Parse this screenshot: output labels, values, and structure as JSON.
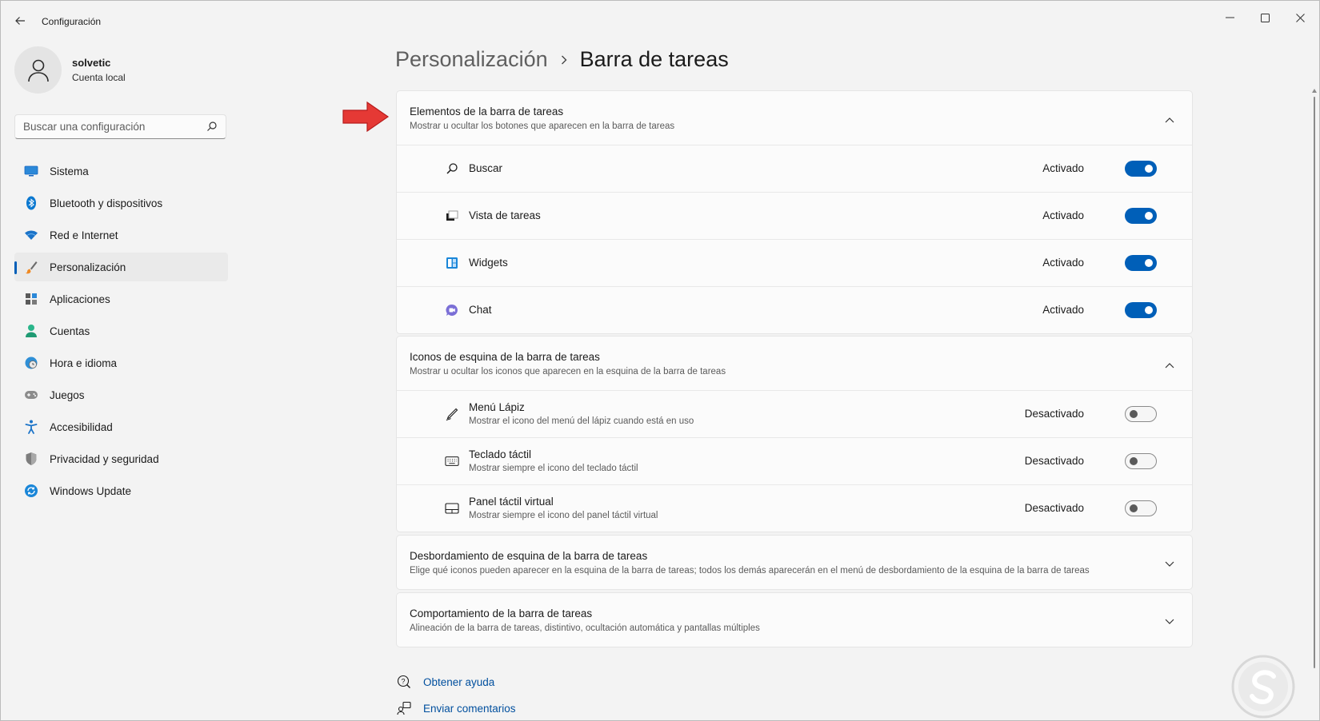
{
  "window": {
    "title": "Configuración"
  },
  "profile": {
    "name": "solvetic",
    "account_type": "Cuenta local"
  },
  "search": {
    "placeholder": "Buscar una configuración"
  },
  "sidebar": {
    "items": [
      {
        "label": "Sistema",
        "icon": "monitor-icon",
        "active": false
      },
      {
        "label": "Bluetooth y dispositivos",
        "icon": "bluetooth-icon",
        "active": false
      },
      {
        "label": "Red e Internet",
        "icon": "wifi-icon",
        "active": false
      },
      {
        "label": "Personalización",
        "icon": "brush-icon",
        "active": true
      },
      {
        "label": "Aplicaciones",
        "icon": "apps-icon",
        "active": false
      },
      {
        "label": "Cuentas",
        "icon": "person-icon",
        "active": false
      },
      {
        "label": "Hora e idioma",
        "icon": "clock-globe-icon",
        "active": false
      },
      {
        "label": "Juegos",
        "icon": "gamepad-icon",
        "active": false
      },
      {
        "label": "Accesibilidad",
        "icon": "accessibility-icon",
        "active": false
      },
      {
        "label": "Privacidad y seguridad",
        "icon": "shield-icon",
        "active": false
      },
      {
        "label": "Windows Update",
        "icon": "update-icon",
        "active": false
      }
    ]
  },
  "breadcrumb": {
    "parent": "Personalización",
    "current": "Barra de tareas"
  },
  "sections": {
    "taskbar_items": {
      "title": "Elementos de la barra de tareas",
      "subtitle": "Mostrar u ocultar los botones que aparecen en la barra de tareas",
      "expanded": true,
      "rows": [
        {
          "label": "Buscar",
          "state": "Activado",
          "on": true,
          "icon": "search-icon"
        },
        {
          "label": "Vista de tareas",
          "state": "Activado",
          "on": true,
          "icon": "task-view-icon"
        },
        {
          "label": "Widgets",
          "state": "Activado",
          "on": true,
          "icon": "widgets-icon"
        },
        {
          "label": "Chat",
          "state": "Activado",
          "on": true,
          "icon": "chat-icon"
        }
      ]
    },
    "corner_icons": {
      "title": "Iconos de esquina de la barra de tareas",
      "subtitle": "Mostrar u ocultar los iconos que aparecen en la esquina de la barra de tareas",
      "expanded": true,
      "rows": [
        {
          "label": "Menú Lápiz",
          "desc": "Mostrar el icono del menú del lápiz cuando está en uso",
          "state": "Desactivado",
          "on": false,
          "icon": "pen-icon"
        },
        {
          "label": "Teclado táctil",
          "desc": "Mostrar siempre el icono del teclado táctil",
          "state": "Desactivado",
          "on": false,
          "icon": "keyboard-icon"
        },
        {
          "label": "Panel táctil virtual",
          "desc": "Mostrar siempre el icono del panel táctil virtual",
          "state": "Desactivado",
          "on": false,
          "icon": "touchpad-icon"
        }
      ]
    },
    "corner_overflow": {
      "title": "Desbordamiento de esquina de la barra de tareas",
      "subtitle": "Elige qué iconos pueden aparecer en la esquina de la barra de tareas; todos los demás aparecerán en el menú de desbordamiento de la esquina de la barra de tareas",
      "expanded": false
    },
    "behavior": {
      "title": "Comportamiento de la barra de tareas",
      "subtitle": "Alineación de la barra de tareas, distintivo, ocultación automática y pantallas múltiples",
      "expanded": false
    }
  },
  "links": {
    "help": "Obtener ayuda",
    "feedback": "Enviar comentarios"
  },
  "colors": {
    "accent": "#005fb8",
    "annotation_arrow": "#e53935"
  }
}
